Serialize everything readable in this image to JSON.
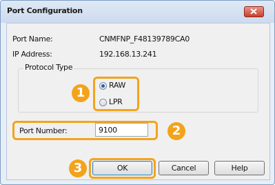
{
  "window": {
    "title": "Port Configuration",
    "close_icon": "close-icon",
    "close_button_color": "#c9402c"
  },
  "fields": {
    "port_name_label": "Port Name:",
    "port_name_value": "CNMFNP_F48139789CA0",
    "ip_address_label": "IP Address:",
    "ip_address_value": "192.168.13.241"
  },
  "protocol": {
    "group_label": "Protocol Type",
    "options": [
      {
        "label": "RAW",
        "selected": true
      },
      {
        "label": "LPR",
        "selected": false
      }
    ]
  },
  "port_number": {
    "label": "Port Number:",
    "value": "9100"
  },
  "buttons": {
    "ok": "OK",
    "cancel": "Cancel",
    "help": "Help"
  },
  "callouts": {
    "color": "#f3a31b",
    "step1": "1",
    "step2": "2",
    "step3": "3"
  }
}
